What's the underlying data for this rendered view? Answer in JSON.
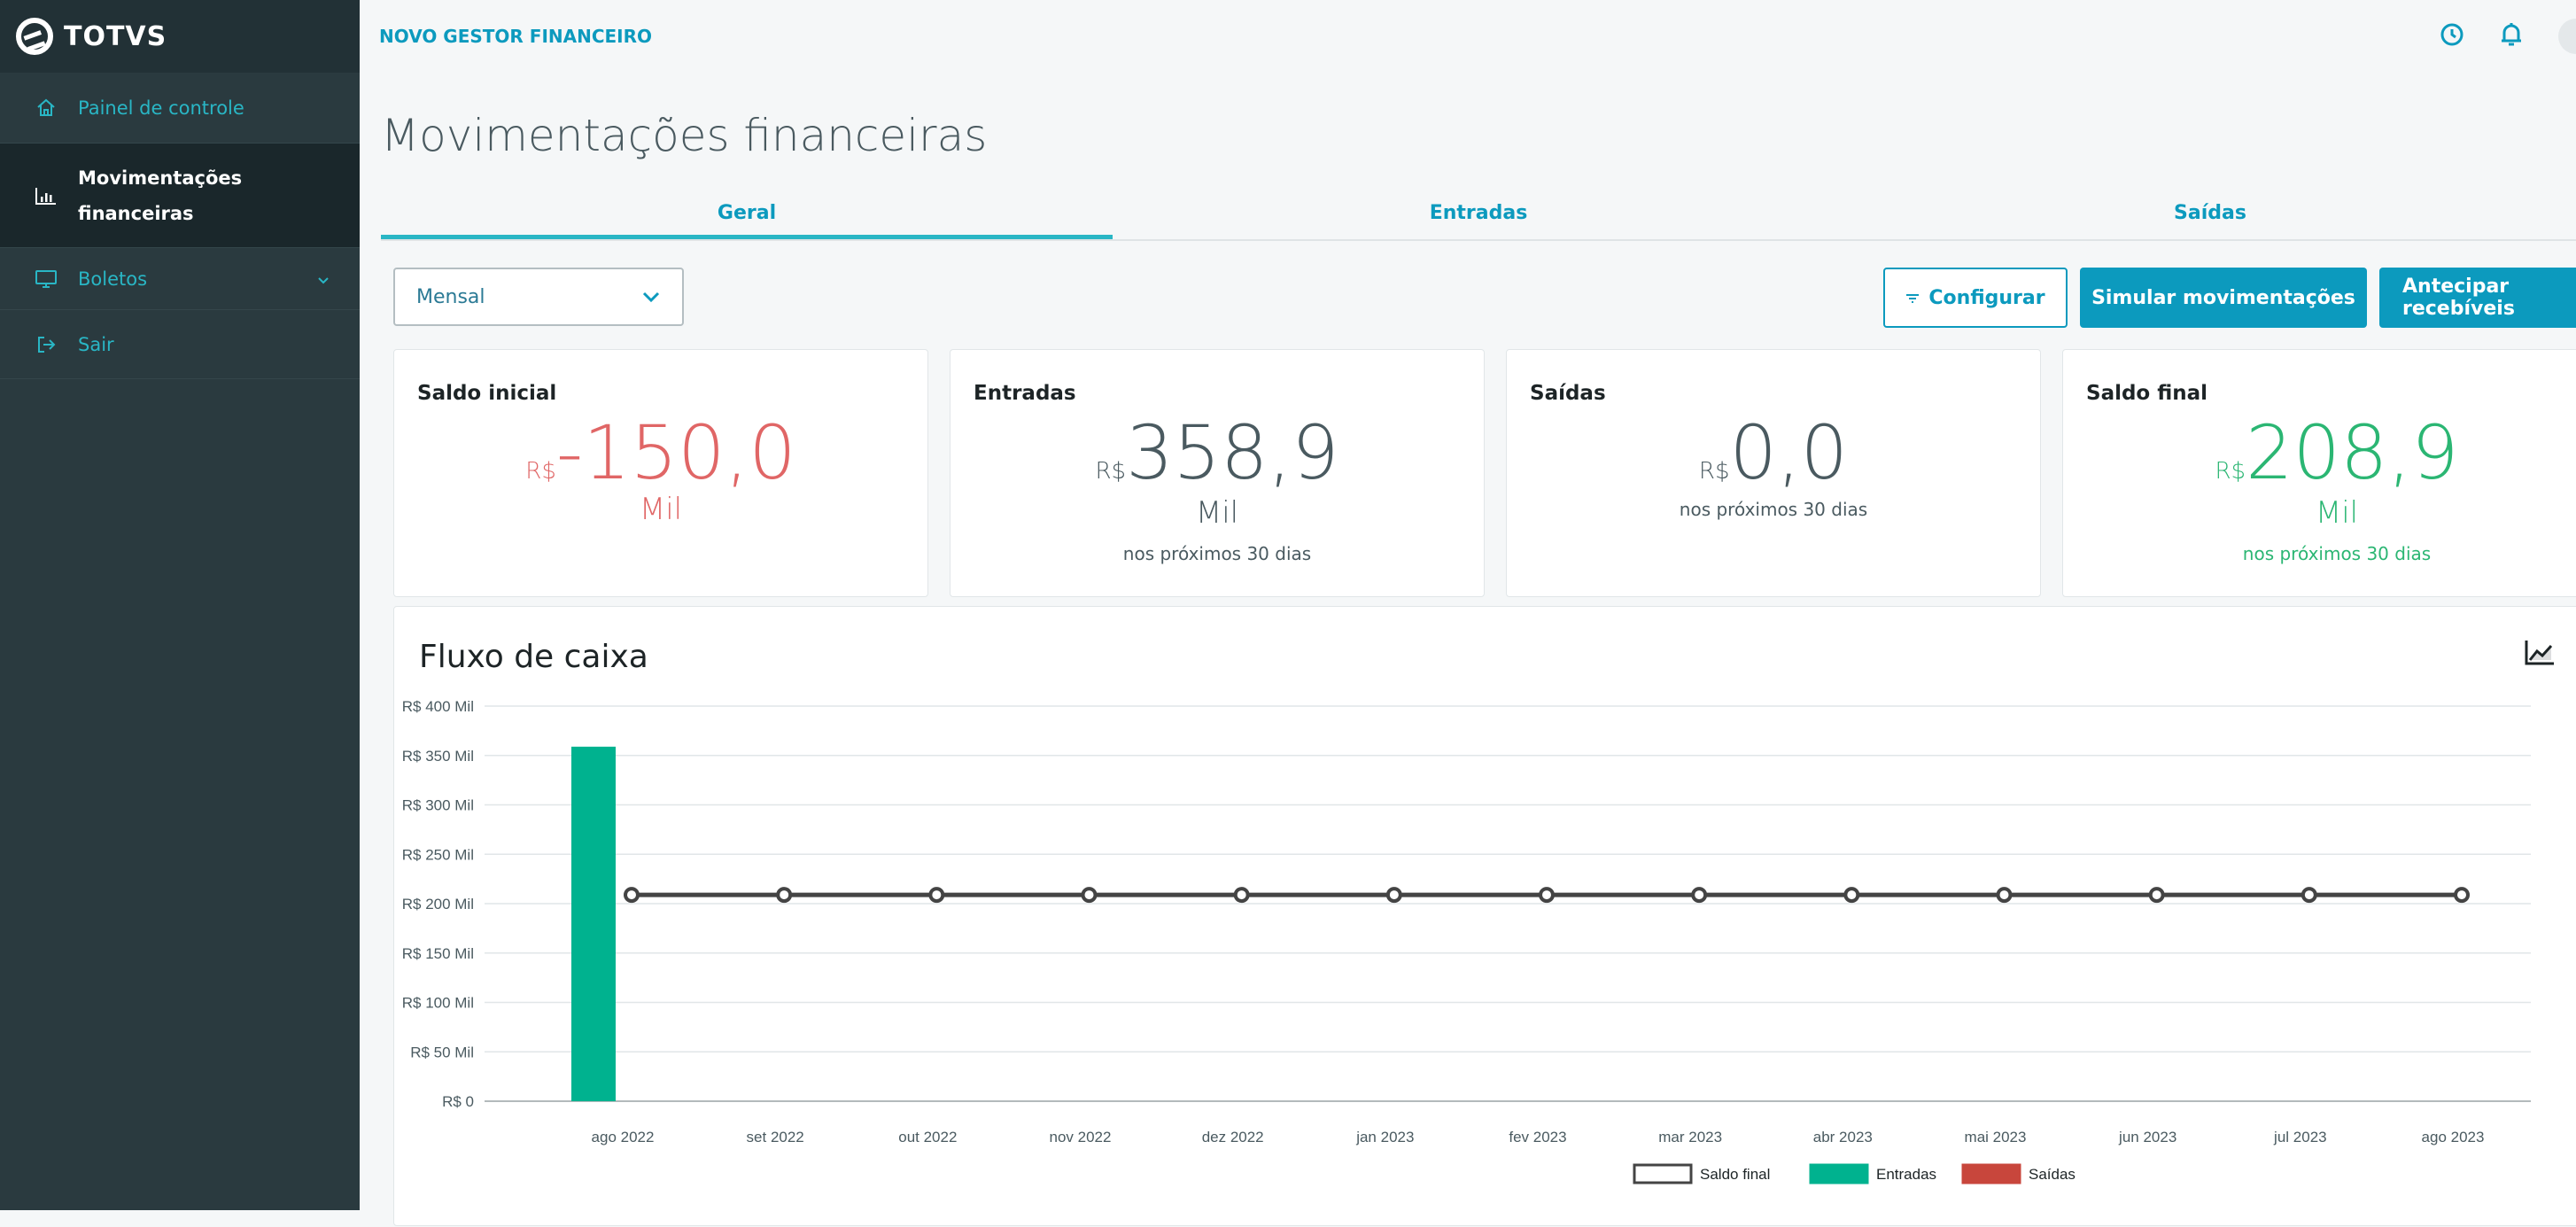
{
  "app": {
    "brand": "TOTVS",
    "product": "NOVO GESTOR FINANCEIRO"
  },
  "sidebar": {
    "items": [
      {
        "label": "Painel de controle",
        "icon": "home-icon"
      },
      {
        "label_line1": "Movimentações",
        "label_line2": "financeiras",
        "icon": "bar-chart-icon",
        "active": true
      },
      {
        "label": "Boletos",
        "icon": "monitor-icon"
      },
      {
        "label": "Sair",
        "icon": "exit-icon"
      }
    ]
  },
  "header": {
    "icons": [
      "clock-icon",
      "bell-icon",
      "avatar"
    ]
  },
  "page": {
    "title": "Movimentações financeiras"
  },
  "tabs": [
    {
      "label": "Geral",
      "active": true
    },
    {
      "label": "Entradas",
      "active": false
    },
    {
      "label": "Saídas",
      "active": false
    }
  ],
  "toolbar": {
    "period_value": "Mensal",
    "configure_label": "Configurar",
    "simulate_label": "Simular movimentações",
    "anticipate_label": "Antecipar recebíveis"
  },
  "cards": [
    {
      "label": "Saldo inicial",
      "currency": "R$",
      "value": "-150,0",
      "unit": "Mil",
      "note": "",
      "color": "#e06666"
    },
    {
      "label": "Entradas",
      "currency": "R$",
      "value": "358,9",
      "unit": "Mil",
      "note": "nos próximos 30 dias",
      "color": "#4a5a60"
    },
    {
      "label": "Saídas",
      "currency": "R$",
      "value": "0,0",
      "unit": "",
      "note": "nos próximos 30 dias",
      "color": "#4a5a60"
    },
    {
      "label": "Saldo final",
      "currency": "R$",
      "value": "208,9",
      "unit": "Mil",
      "note": "nos próximos 30 dias",
      "color": "#2bb673"
    }
  ],
  "chart": {
    "title": "Fluxo de caixa",
    "colors": {
      "saldo": "#444444",
      "entradas": "#00b28f",
      "saidas": "#c8463c"
    }
  },
  "chart_data": {
    "type": "bar",
    "title": "Fluxo de caixa",
    "categories": [
      "ago 2022",
      "set 2022",
      "out 2022",
      "nov 2022",
      "dez 2022",
      "jan 2023",
      "fev 2023",
      "mar 2023",
      "abr 2023",
      "mai 2023",
      "jun 2023",
      "jul 2023",
      "ago 2023"
    ],
    "y_ticks": [
      "R$ 400 Mil",
      "R$ 350 Mil",
      "R$ 300 Mil",
      "R$ 250 Mil",
      "R$ 200 Mil",
      "R$ 150 Mil",
      "R$ 100 Mil",
      "R$ 50 Mil",
      "R$ 0"
    ],
    "ylim": [
      0,
      400
    ],
    "grid": true,
    "legend_position": "bottom",
    "series": [
      {
        "name": "Saldo final",
        "type": "line",
        "values": [
          208.9,
          208.9,
          208.9,
          208.9,
          208.9,
          208.9,
          208.9,
          208.9,
          208.9,
          208.9,
          208.9,
          208.9,
          208.9
        ]
      },
      {
        "name": "Entradas",
        "type": "bar",
        "values": [
          358.9,
          0,
          0,
          0,
          0,
          0,
          0,
          0,
          0,
          0,
          0,
          0,
          0
        ]
      },
      {
        "name": "Saídas",
        "type": "bar",
        "values": [
          0,
          0,
          0,
          0,
          0,
          0,
          0,
          0,
          0,
          0,
          0,
          0,
          0
        ]
      }
    ]
  }
}
